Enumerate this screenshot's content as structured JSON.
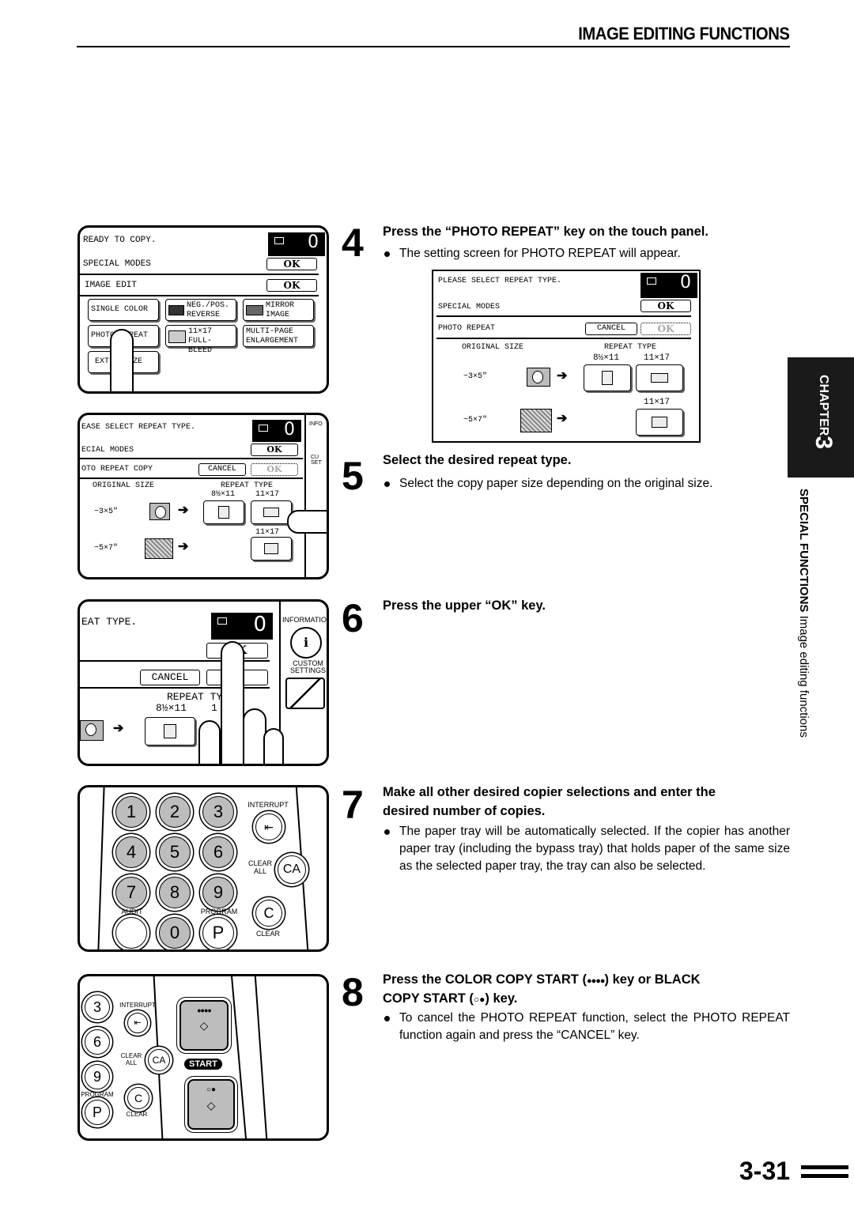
{
  "header": {
    "section_title": "IMAGE EDITING FUNCTIONS"
  },
  "side_tab": {
    "chapter_label": "CHAPTER",
    "chapter_number": "3",
    "section": "SPECIAL FUNCTIONS",
    "subsection": "Image editing functions"
  },
  "page_number": "3-31",
  "panel1": {
    "status": "READY TO COPY.",
    "counter": "0",
    "rows": [
      {
        "label": "SPECIAL MODES",
        "button": "OK"
      },
      {
        "label": "IMAGE EDIT",
        "button": "OK"
      }
    ],
    "keys": [
      {
        "label": "SINGLE COLOR"
      },
      {
        "label": "NEG./POS. REVERSE",
        "line1": "NEG./POS.",
        "line2": "REVERSE",
        "icon": "neg-pos-icon"
      },
      {
        "label": "MIRROR IMAGE",
        "line1": "MIRROR",
        "line2": "IMAGE",
        "icon": "mirror-icon"
      },
      {
        "label": "PHOTO REPEAT"
      },
      {
        "label": "11×17 FULL-BLEED",
        "line1": "11×17",
        "line2": "FULL-BLEED",
        "icon": "full-bleed-icon"
      },
      {
        "label": "MULTI-PAGE ENLARGEMENT",
        "line1": "MULTI-PAGE",
        "line2": "ENLARGEMENT"
      },
      {
        "label": "EXTRA SIZE",
        "visible": "EXT    IZE"
      }
    ]
  },
  "panel2": {
    "status": "EASE SELECT REPEAT TYPE.",
    "counter": "0",
    "rows": [
      {
        "label": "ECIAL MODES",
        "button": "OK"
      },
      {
        "label": "OTO REPEAT COPY",
        "cancel": "CANCEL",
        "button": "OK"
      }
    ],
    "original_size_label": "ORIGINAL SIZE",
    "repeat_type_label": "REPEAT TYPE",
    "sizes": [
      "8½×11",
      "11×17",
      "11×17"
    ],
    "originals": [
      "~3×5\"",
      "~5×7\""
    ],
    "side": {
      "info": "INFO",
      "custom": "CU SET"
    }
  },
  "panel3": {
    "status": "EAT TYPE.",
    "counter": "0",
    "ok": "OK",
    "cancel": "CANCEL",
    "repeat_type_label": "REPEAT TY",
    "size": "8½×11",
    "size2": "1",
    "side": {
      "info": "INFORMATIO",
      "custom1": "CUSTOM",
      "custom2": "SETTINGS"
    }
  },
  "keypad": {
    "digits": [
      "1",
      "2",
      "3",
      "4",
      "5",
      "6",
      "7",
      "8",
      "9"
    ],
    "audit": "AUDIT",
    "zero": "0",
    "program_label": "PROGRAM",
    "program_key": "P",
    "interrupt": "INTERRUPT",
    "clear_all_1": "CLEAR",
    "clear_all_2": "ALL",
    "ca": "CA",
    "c": "C",
    "clear": "CLEAR"
  },
  "start_panel": {
    "keys": [
      "3",
      "6",
      "9",
      "P"
    ],
    "interrupt": "INTERRUPT",
    "clear_all_1": "CLEAR",
    "clear_all_2": "ALL",
    "ca": "CA",
    "program": "PROGRAM",
    "c": "C",
    "clear": "CLEAR",
    "start": "START",
    "color_symbol": "●●●●",
    "black_symbol": "○●"
  },
  "screen4": {
    "status": "PLEASE SELECT REPEAT TYPE.",
    "counter": "0",
    "rows": [
      {
        "label": "SPECIAL MODES",
        "button": "OK"
      },
      {
        "label": "PHOTO REPEAT",
        "cancel": "CANCEL",
        "button": "OK"
      }
    ],
    "original_size_label": "ORIGINAL SIZE",
    "repeat_type_label": "REPEAT TYPE",
    "sizes": [
      "8½×11",
      "11×17",
      "11×17"
    ],
    "originals": [
      "~3×5\"",
      "~5×7\""
    ]
  },
  "steps": [
    {
      "num": "4",
      "heading": "Press the “PHOTO REPEAT” key on the touch panel.",
      "bullets": [
        "The setting screen for PHOTO REPEAT will appear."
      ]
    },
    {
      "num": "5",
      "heading": "Select the desired repeat type.",
      "bullets": [
        "Select the copy paper size depending on the original size."
      ]
    },
    {
      "num": "6",
      "heading": "Press the upper “OK” key.",
      "bullets": []
    },
    {
      "num": "7",
      "heading_1": "Make all other desired copier selections and enter the",
      "heading_2": "desired number of copies.",
      "bullets": [
        "The paper tray will be automatically selected. If the copier has another paper tray (including the bypass tray) that holds paper of the same size as the selected paper tray, the tray can also be selected."
      ]
    },
    {
      "num": "8",
      "heading_1a": "Press the COLOR COPY START (",
      "heading_1sym": "●●●●",
      "heading_1b": ") key or BLACK",
      "heading_2a": "COPY START (",
      "heading_2sym": "○●",
      "heading_2b": ") key.",
      "bullets": [
        "To cancel the PHOTO REPEAT function, select the PHOTO REPEAT function again and press the “CANCEL” key."
      ]
    }
  ]
}
